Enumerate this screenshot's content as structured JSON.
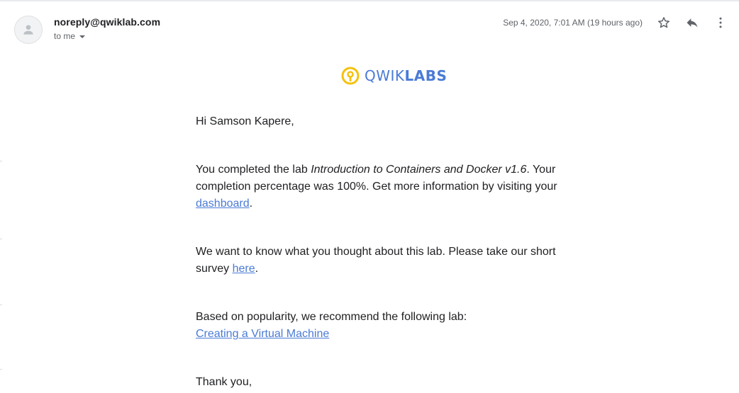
{
  "header": {
    "sender": "noreply@qwiklab.com",
    "recipient_label": "to me",
    "timestamp": "Sep 4, 2020, 7:01 AM (19 hours ago)"
  },
  "icons": {
    "avatar": "person-icon",
    "star": "star-icon",
    "reply": "reply-icon",
    "more": "more-vert-icon",
    "logo": "qwiklabs-logo-icon"
  },
  "logo": {
    "part1": "QWIK",
    "part2": "LABS",
    "color": "#4a7bd6",
    "accent": "#f4c20d"
  },
  "email": {
    "greeting": "Hi Samson Kapere,",
    "completed_prefix": "You completed the lab ",
    "lab_name": "Introduction to Containers and Docker v1.6",
    "completed_suffix": ". Your completion percentage was 100%. Get more information by visiting your ",
    "dashboard_link": "dashboard",
    "period": ".",
    "survey_prefix": "We want to know what you thought about this lab. Please take our short survey ",
    "survey_link": "here",
    "recommend_text": "Based on popularity, we recommend the following lab:",
    "recommend_link": "Creating a Virtual Machine",
    "thanks": "Thank you,"
  },
  "colors": {
    "link": "#4a7bd6",
    "text": "#202124",
    "muted": "#5f6368"
  }
}
